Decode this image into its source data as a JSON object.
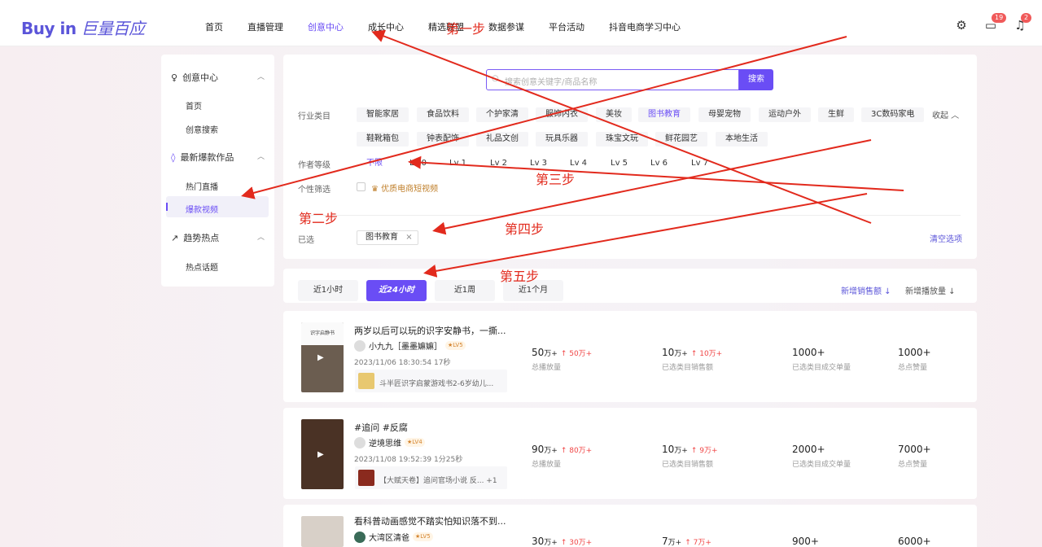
{
  "header": {
    "logo": "Buy in",
    "logo_cn": "巨量百应",
    "nav": [
      "首页",
      "直播管理",
      "创意中心",
      "成长中心",
      "精选联盟",
      "数据参谋",
      "平台活动",
      "抖音电商学习中心"
    ],
    "active_nav": 2,
    "messages_badge": "19",
    "notifications_badge": "2"
  },
  "sidebar": {
    "groups": [
      {
        "label": "创意中心",
        "items": [
          "首页",
          "创意搜索"
        ]
      },
      {
        "label": "最新爆款作品",
        "items": [
          "热门直播",
          "爆款视频"
        ]
      },
      {
        "label": "趋势热点",
        "items": [
          "热点话题"
        ]
      }
    ]
  },
  "search": {
    "placeholder": "搜索创意关键字/商品名称",
    "button": "搜索"
  },
  "filters": {
    "industry_label": "行业类目",
    "industry": [
      "智能家居",
      "食品饮料",
      "个护家清",
      "服饰内衣",
      "美妆",
      "图书教育",
      "母婴宠物",
      "运动户外",
      "生鲜",
      "3C数码家电",
      "鞋靴箱包",
      "钟表配饰",
      "礼品文创",
      "玩具乐器",
      "珠宝文玩",
      "鲜花园艺",
      "本地生活"
    ],
    "industry_active": "图书教育",
    "collapse": "收起",
    "author_label": "作者等级",
    "levels": [
      "不限",
      "Lv 0",
      "Lv 1",
      "Lv 2",
      "Lv 3",
      "Lv 4",
      "Lv 5",
      "Lv 6",
      "Lv 7"
    ],
    "level_active": "不限",
    "personal_label": "个性筛选",
    "quality": "优质电商短视频",
    "selected_label": "已选",
    "selected_chip": "图书教育",
    "clear": "清空选项"
  },
  "time": {
    "buttons": [
      "近1小时",
      "近24小时",
      "近1周",
      "近1个月"
    ],
    "active": "近24小时",
    "sort1": "新增销售额",
    "sort2": "新增播放量"
  },
  "cards": [
    {
      "thumb_text": "识字启静书",
      "title": "两岁以后可以玩的识字安静书，一撕...",
      "author": "小九九［墨墨嫲嫲］",
      "level": "LV5",
      "meta": "2023/11/06 18:30:54  17秒",
      "product": "斗半匠识字启蒙游戏书2-6岁幼儿...",
      "metrics": [
        {
          "v": "50",
          "u": "万+",
          "inc": "50万+",
          "lbl": "总播放量"
        },
        {
          "v": "10",
          "u": "万+",
          "inc": "10万+",
          "lbl": "已选类目销售额"
        },
        {
          "v": "1000+",
          "u": "",
          "inc": "",
          "lbl": "已选类目成交单量"
        },
        {
          "v": "1000+",
          "u": "",
          "inc": "",
          "lbl": "总点赞量"
        }
      ]
    },
    {
      "thumb_text": "",
      "title": "#追问 #反腐",
      "author": "逆境思维",
      "level": "LV4",
      "meta": "2023/11/08 19:52:39  1分25秒",
      "product": "【大赋天卷】追问官场小说 反...  +1",
      "metrics": [
        {
          "v": "90",
          "u": "万+",
          "inc": "80万+",
          "lbl": "总播放量"
        },
        {
          "v": "10",
          "u": "万+",
          "inc": "9万+",
          "lbl": "已选类目销售额"
        },
        {
          "v": "2000+",
          "u": "",
          "inc": "",
          "lbl": "已选类目成交单量"
        },
        {
          "v": "7000+",
          "u": "",
          "inc": "",
          "lbl": "总点赞量"
        }
      ]
    },
    {
      "thumb_text": "",
      "title": "看科普动画感觉不踏实怕知识落不到...",
      "author": "大湾区清爸",
      "level": "LV5",
      "meta": "",
      "product": "",
      "metrics": [
        {
          "v": "30",
          "u": "万+",
          "inc": "30万+",
          "lbl": ""
        },
        {
          "v": "7",
          "u": "万+",
          "inc": "7万+",
          "lbl": ""
        },
        {
          "v": "900+",
          "u": "",
          "inc": "",
          "lbl": ""
        },
        {
          "v": "6000+",
          "u": "",
          "inc": "",
          "lbl": ""
        }
      ]
    }
  ],
  "annotations": {
    "step1": "第一步",
    "step2": "第二步",
    "step3": "第三步",
    "step4": "第四步",
    "step5": "第五步",
    "color": "#e22a1d"
  }
}
